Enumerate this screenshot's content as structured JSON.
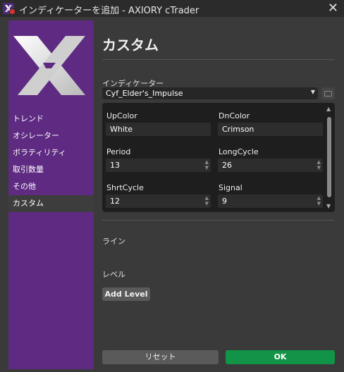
{
  "window": {
    "title": "インディケーターを追加 - AXIORY cTrader",
    "close_glyph": "✕"
  },
  "sidebar": {
    "items": [
      {
        "label": "トレンド"
      },
      {
        "label": "オシレーター"
      },
      {
        "label": "ボラティリティ"
      },
      {
        "label": "取引数量"
      },
      {
        "label": "その他"
      },
      {
        "label": "カスタム",
        "active": true
      }
    ]
  },
  "main": {
    "title": "カスタム",
    "indicator_label": "インディケーター",
    "indicator_value": "Cyf_Elder's_Impulse",
    "params": [
      {
        "label": "UpColor",
        "value": "White"
      },
      {
        "label": "DnColor",
        "value": "Crimson"
      },
      {
        "label": "Period",
        "value": "13"
      },
      {
        "label": "LongCycle",
        "value": "26"
      },
      {
        "label": "ShrtCycle",
        "value": "12"
      },
      {
        "label": "Signal",
        "value": "9"
      }
    ],
    "lines_label": "ライン",
    "levels_label": "レベル",
    "add_level_label": "Add Level"
  },
  "footer": {
    "reset_label": "リセット",
    "ok_label": "OK"
  },
  "colors": {
    "sidebar": "#5e2a82",
    "ok": "#119447",
    "background": "#3a3a3a"
  }
}
